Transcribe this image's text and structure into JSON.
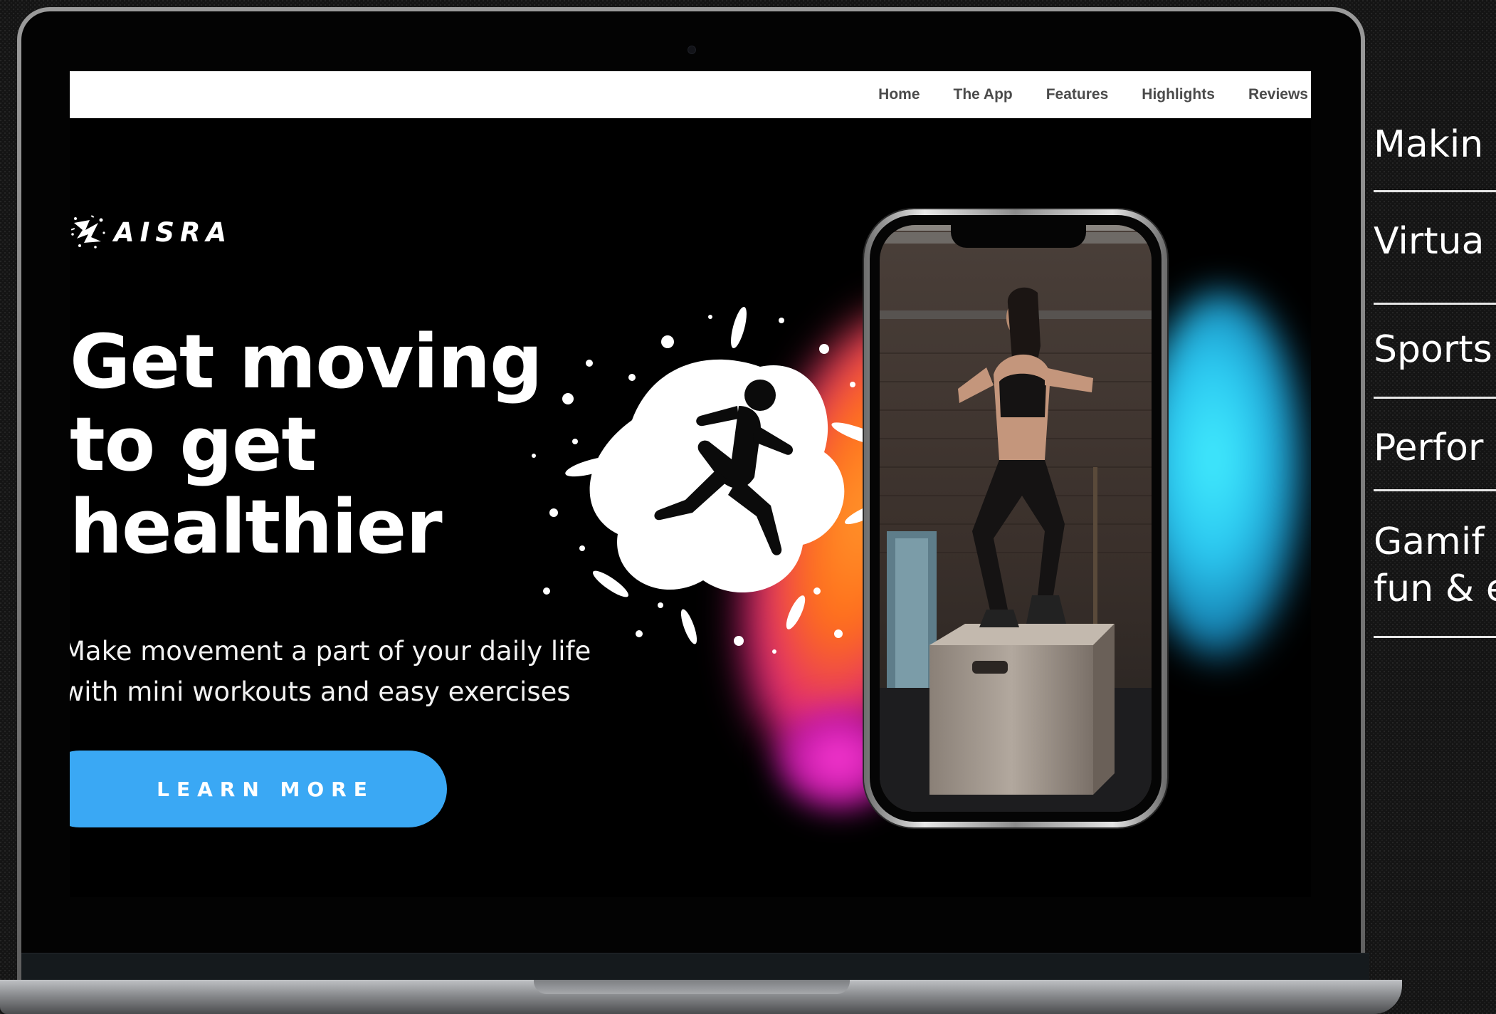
{
  "nav": {
    "links": [
      "Home",
      "The App",
      "Features",
      "Highlights",
      "Reviews"
    ]
  },
  "brand": {
    "name": "AISRA"
  },
  "hero": {
    "headline_lines": [
      "Get moving",
      "to get",
      "healthier"
    ],
    "subtext_lines": [
      "Make movement a part of your daily life",
      "with mini workouts and easy exercises"
    ],
    "cta_label": "LEARN MORE"
  },
  "feature_list": {
    "items": [
      "Makin",
      "Virtua",
      "Sports",
      "Perfor",
      "Gamif",
      "fun & e"
    ]
  },
  "colors": {
    "cta": "#3aa8f4",
    "nav_bg": "#ffffff",
    "nav_text": "#4b4b4b",
    "screen_bg": "#000000",
    "glow_orange": "#ff8a2a",
    "glow_pink": "#ff3bd6",
    "glow_cyan": "#45f0ff"
  },
  "icons": [
    "brand-logo-icon",
    "runner-splash-icon"
  ]
}
